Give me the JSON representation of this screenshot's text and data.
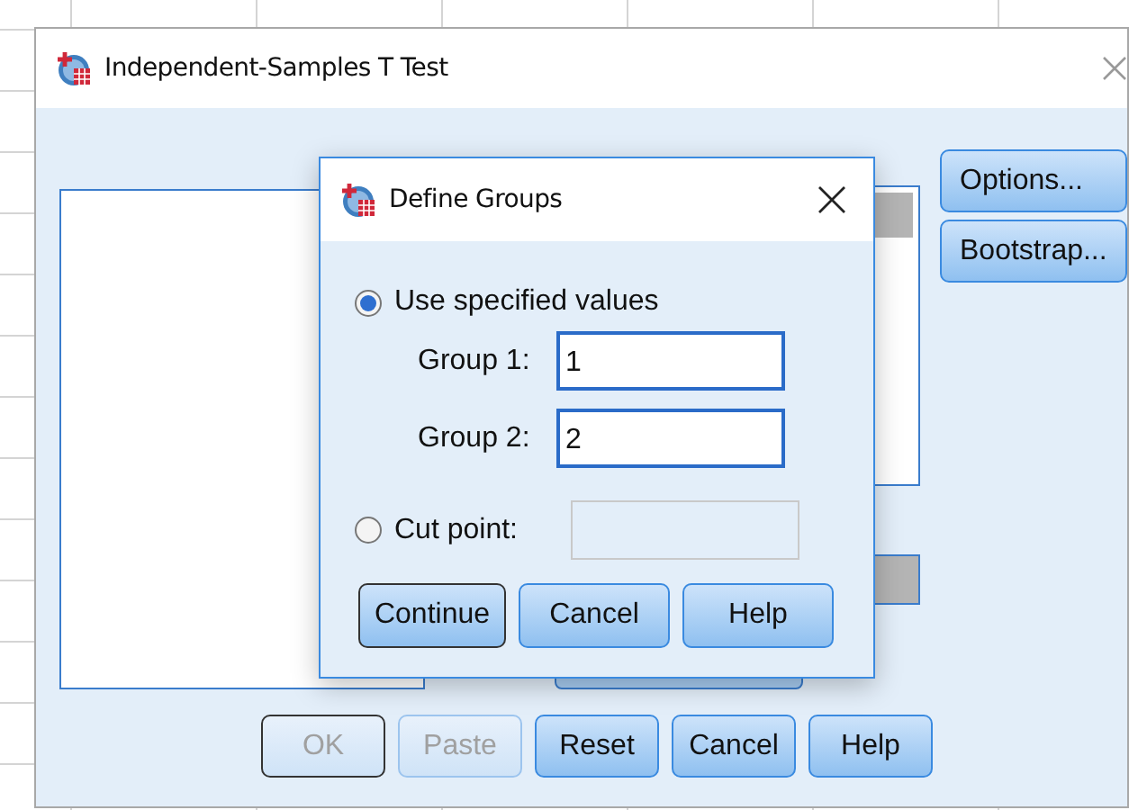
{
  "background_window": {
    "title": "Independent-Samples T Test",
    "side_buttons": [
      {
        "label": "Options..."
      },
      {
        "label": "Bootstrap..."
      }
    ],
    "buttons": [
      {
        "label": "OK",
        "default": true,
        "disabled": true
      },
      {
        "label": "Paste",
        "default": false,
        "disabled": true
      },
      {
        "label": "Reset",
        "default": false,
        "disabled": false
      },
      {
        "label": "Cancel",
        "default": false,
        "disabled": false
      },
      {
        "label": "Help",
        "default": false,
        "disabled": false
      }
    ]
  },
  "dialog": {
    "title": "Define Groups",
    "options": [
      {
        "label": "Use specified values",
        "selected": true
      },
      {
        "label": "Cut point:",
        "selected": false
      }
    ],
    "fields": [
      {
        "label": "Group 1:",
        "value": "1"
      },
      {
        "label": "Group 2:",
        "value": "2"
      }
    ],
    "cut_point_field": {
      "disabled": true
    },
    "buttons": [
      {
        "label": "Continue",
        "default": true
      },
      {
        "label": "Cancel",
        "default": false
      },
      {
        "label": "Help",
        "default": false
      }
    ]
  }
}
